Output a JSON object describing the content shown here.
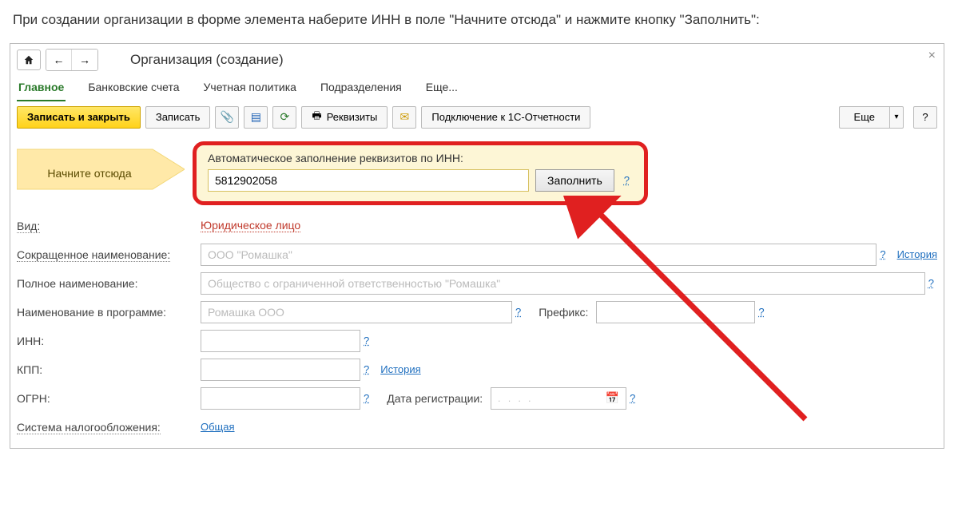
{
  "intro": "При создании организации в форме элемента наберите ИНН в поле \"Начните отсюда\" и нажмите кнопку \"Заполнить\":",
  "window": {
    "title": "Организация (создание)",
    "close": "×"
  },
  "tabs": {
    "main": "Главное",
    "accounts": "Банковские счета",
    "policy": "Учетная политика",
    "divisions": "Подразделения",
    "more": "Еще..."
  },
  "toolbar": {
    "save_close": "Записать и закрыть",
    "save": "Записать",
    "requisites": "Реквизиты",
    "connect": "Подключение к 1С-Отчетности",
    "more": "Еще",
    "help": "?"
  },
  "start_marker": {
    "label": "Начните отсюда"
  },
  "highlight": {
    "title": "Автоматическое заполнение реквизитов по ИНН:",
    "inn_value": "5812902058",
    "fill_btn": "Заполнить",
    "help": "?"
  },
  "fields": {
    "type_label": "Вид:",
    "type_value": "Юридическое лицо",
    "short_name_label": "Сокращенное наименование:",
    "short_name_ph": "ООО \"Ромашка\"",
    "full_name_label": "Полное наименование:",
    "full_name_ph": "Общество с ограниченной ответственностью \"Ромашка\"",
    "prog_name_label": "Наименование в программе:",
    "prog_name_ph": "Ромашка ООО",
    "prefix_label": "Префикс:",
    "inn_label": "ИНН:",
    "kpp_label": "КПП:",
    "ogrn_label": "ОГРН:",
    "reg_date_label": "Дата регистрации:",
    "reg_date_ph": ". . . .",
    "tax_system_label": "Система налогообложения:",
    "tax_system_value": "Общая",
    "history": "История",
    "help": "?"
  }
}
